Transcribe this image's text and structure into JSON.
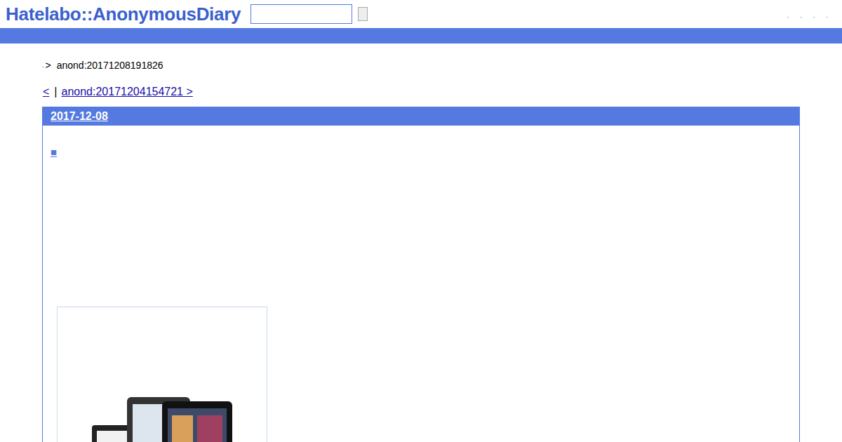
{
  "header": {
    "logo": "Hatelabo::AnonymousDiary",
    "search": {
      "value": ""
    },
    "links": [
      ".",
      ".",
      ".",
      "."
    ]
  },
  "breadcrumb": {
    "prefix": ".",
    "separator": ">",
    "current": "anond:20171208191826"
  },
  "nav": {
    "prev": "<",
    "separator": "|",
    "next": "anond:20171204154721 >"
  },
  "entry": {
    "date": "2017-12-08",
    "marker": "■"
  }
}
